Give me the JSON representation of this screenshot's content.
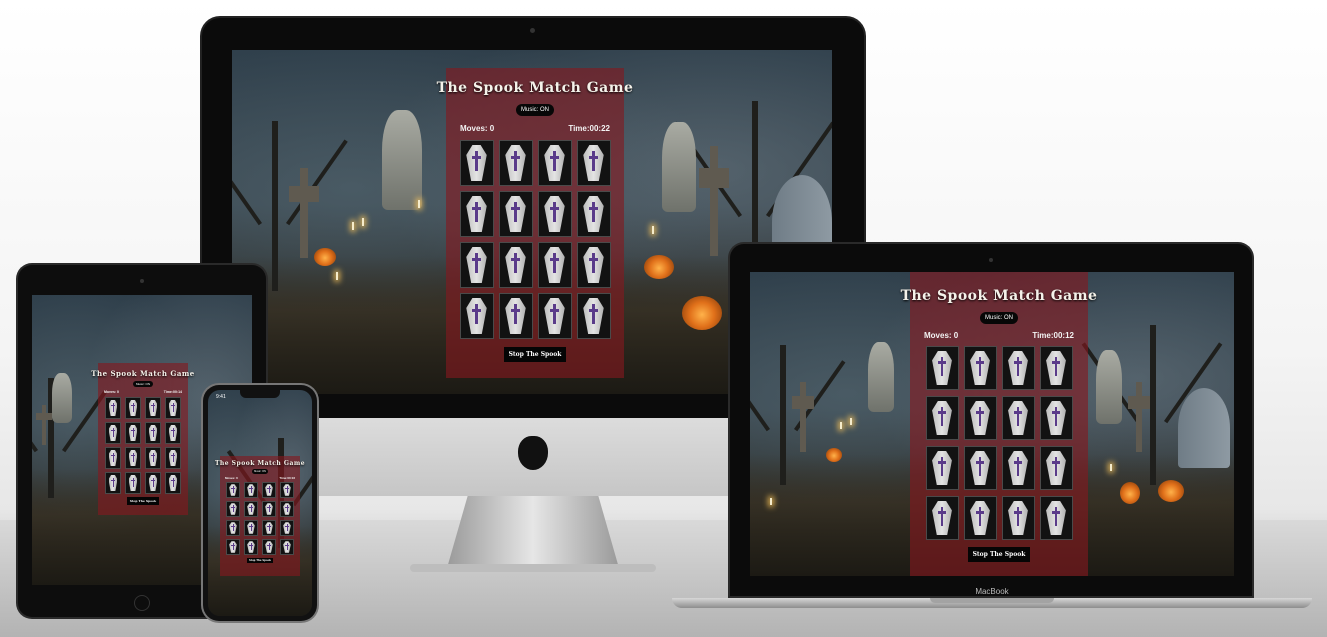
{
  "game": {
    "title": "The Spook Match Game",
    "music_label": "Music: ON",
    "stop_label": "Stop The Spook",
    "cards_per_board": 16
  },
  "devices": {
    "desktop": {
      "moves": "Moves: 0",
      "time": "Time:00:22"
    },
    "laptop": {
      "moves": "Moves: 0",
      "time": "Time:00:12",
      "brand": "MacBook"
    },
    "tablet": {
      "moves": "Moves: 0",
      "time": "Time:00:14"
    },
    "phone": {
      "moves": "Moves: 0",
      "time": "Time:00:16",
      "clock": "9:41"
    }
  },
  "colors": {
    "panel": "#84181e",
    "button": "#050505",
    "coffin_cross": "#5a3b8a"
  }
}
